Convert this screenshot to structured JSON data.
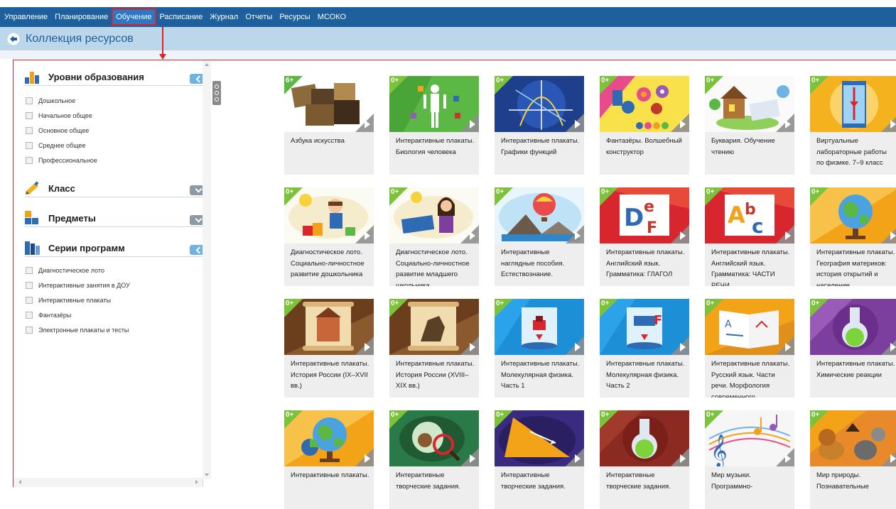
{
  "menu": {
    "items": [
      {
        "label": "Управление"
      },
      {
        "label": "Планирование"
      },
      {
        "label": "Обучение",
        "active": true
      },
      {
        "label": "Расписание"
      },
      {
        "label": "Журнал"
      },
      {
        "label": "Отчеты"
      },
      {
        "label": "Ресурсы"
      },
      {
        "label": "МСОКО"
      }
    ]
  },
  "page": {
    "title": "Коллекция ресурсов"
  },
  "colors": {
    "menu_bg": "#1e5f9e",
    "title_bg": "#bcd6ea",
    "accent_red": "#d9262c",
    "toggle_open": "#6fb3e6",
    "toggle_closed": "#8d9aa6"
  },
  "filters": {
    "levels": {
      "title": "Уровни образования",
      "expanded": true,
      "options": [
        "Дошкольное",
        "Начальное общее",
        "Основное общее",
        "Среднее общее",
        "Профессиональное"
      ]
    },
    "class": {
      "title": "Класс",
      "expanded": false
    },
    "subjects": {
      "title": "Предметы",
      "expanded": false
    },
    "series": {
      "title": "Серии программ",
      "expanded": true,
      "options": [
        "Диагностическое лото",
        "Интерактивные занятия в ДОУ",
        "Интерактивные плакаты",
        "Фантазёры",
        "Электронные плакаты и тесты"
      ]
    }
  },
  "resources": [
    {
      "badge": "6+",
      "title": "Азбука искусства",
      "bg": "#7a5a3a",
      "art": "paintings"
    },
    {
      "badge": "0+",
      "title": "Интерактивные плакаты. Биология человека",
      "bg": "#5cb845",
      "art": "body"
    },
    {
      "badge": "0+",
      "title": "Интерактивные плакаты. Графики функций",
      "bg": "#1d3f8c",
      "art": "graph"
    },
    {
      "badge": "0+",
      "title": "Фантазёры. Волшебный конструктор",
      "bg": "#e94b8a",
      "art": "flowers"
    },
    {
      "badge": "0+",
      "title": "Буквария. Обучение чтению",
      "bg": "#f4f4f4",
      "art": "house"
    },
    {
      "badge": "0+",
      "title": "Виртуальные лабораторные работы по физике. 7–9 класс",
      "bg": "#f5b21f",
      "art": "tube"
    },
    {
      "badge": "0+",
      "title": "Диагностическое лото. Социально-личностное развитие дошкольника",
      "bg": "#fbfbf4",
      "art": "boy"
    },
    {
      "badge": "0+",
      "title": "Диагностическое лото. Социально-личностное развитие младшего школьника",
      "bg": "#fbfbf4",
      "art": "girl"
    },
    {
      "badge": "0+",
      "title": "Интерактивные наглядные пособия. Естествознание.",
      "bg": "#eaf4fb",
      "art": "balloon"
    },
    {
      "badge": "0+",
      "title": "Интерактивные плакаты. Английский язык. Грамматика: ГЛАГОЛ",
      "bg": "#d8262e",
      "art": "def"
    },
    {
      "badge": "0+",
      "title": "Интерактивные плакаты. Английский язык. Грамматика: ЧАСТИ РЕЧИ",
      "bg": "#d8262e",
      "art": "abc"
    },
    {
      "badge": "0+",
      "title": "Интерактивные плакаты. География материков: история открытий и население",
      "bg": "#f3a318",
      "art": "globe"
    },
    {
      "badge": "0+",
      "title": "Интерактивные плакаты. История России (IX–XVII вв.)",
      "bg": "#6b3f1e",
      "art": "scroll"
    },
    {
      "badge": "0+",
      "title": "Интерактивные плакаты. История России (XVIII–XIX вв.)",
      "bg": "#6b3f1e",
      "art": "scroll2"
    },
    {
      "badge": "0+",
      "title": "Интерактивные плакаты. Молекулярная физика. Часть 1",
      "bg": "#1d8fd6",
      "art": "cylinder"
    },
    {
      "badge": "0+",
      "title": "Интерактивные плакаты. Молекулярная физика. Часть 2",
      "bg": "#1d8fd6",
      "art": "cylinder2"
    },
    {
      "badge": "0+",
      "title": "Интерактивные плакаты. Русский язык. Части речи. Морфология современного",
      "bg": "#f3a318",
      "art": "book"
    },
    {
      "badge": "0+",
      "title": "Интерактивные плакаты. Химические реакции",
      "bg": "#7c3f9e",
      "art": "flask"
    },
    {
      "badge": "0+",
      "title": "Интерактивные плакаты.",
      "bg": "#f3a318",
      "art": "globe2"
    },
    {
      "badge": "0+",
      "title": "Интерактивные творческие задания.",
      "bg": "#2a7a47",
      "art": "magnifier"
    },
    {
      "badge": "0+",
      "title": "Интерактивные творческие задания.",
      "bg": "#3a2b80",
      "art": "triangle"
    },
    {
      "badge": "0+",
      "title": "Интерактивные творческие задания.",
      "bg": "#8a2a20",
      "art": "flask2"
    },
    {
      "badge": "0+",
      "title": "Мир музыки. Программно-",
      "bg": "#f6f6f6",
      "art": "music"
    },
    {
      "badge": "0+",
      "title": "Мир природы. Познавательные",
      "bg": "#e88a2a",
      "art": "animals"
    }
  ]
}
